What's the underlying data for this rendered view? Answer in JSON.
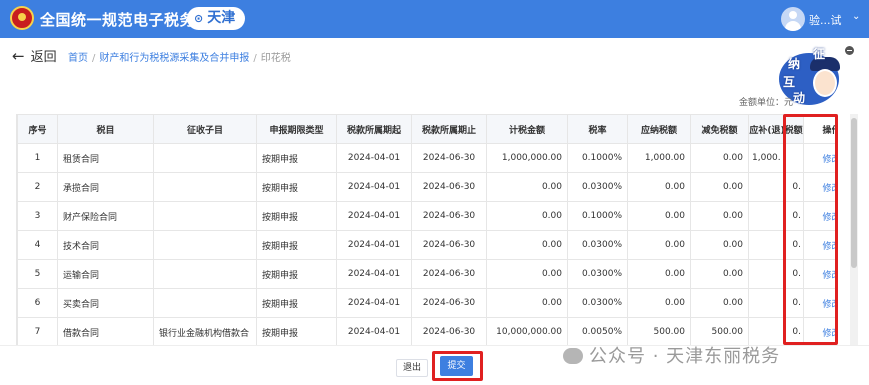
{
  "header": {
    "title": "全国统一规范电子税务局",
    "region": "天津",
    "username": "验...试"
  },
  "breadcrumb": {
    "back": "返回",
    "items": [
      "首页",
      "财产和行为税税源采集及合并申报",
      "印花税"
    ]
  },
  "mascot": {
    "chars": [
      "征",
      "纳",
      "互",
      "动"
    ]
  },
  "unit_label": "金额单位：元",
  "table": {
    "headers": [
      "序号",
      "税目",
      "征收子目",
      "申报期限类型",
      "税款所属期起",
      "税款所属期止",
      "计税金额",
      "税率",
      "应纳税额",
      "减免税额",
      "应补(退)税额",
      "操作"
    ],
    "rows": [
      {
        "no": "1",
        "item": "租赁合同",
        "sub": "",
        "period": "按期申报",
        "start": "2024-04-01",
        "end": "2024-06-30",
        "base": "1,000,000.00",
        "rate": "0.1000%",
        "payable": "1,000.00",
        "relief": "0.00",
        "due": "1,000.",
        "op": "修改"
      },
      {
        "no": "2",
        "item": "承揽合同",
        "sub": "",
        "period": "按期申报",
        "start": "2024-04-01",
        "end": "2024-06-30",
        "base": "0.00",
        "rate": "0.0300%",
        "payable": "0.00",
        "relief": "0.00",
        "due": "0.",
        "op": "修改"
      },
      {
        "no": "3",
        "item": "财产保险合同",
        "sub": "",
        "period": "按期申报",
        "start": "2024-04-01",
        "end": "2024-06-30",
        "base": "0.00",
        "rate": "0.1000%",
        "payable": "0.00",
        "relief": "0.00",
        "due": "0.",
        "op": "修改"
      },
      {
        "no": "4",
        "item": "技术合同",
        "sub": "",
        "period": "按期申报",
        "start": "2024-04-01",
        "end": "2024-06-30",
        "base": "0.00",
        "rate": "0.0300%",
        "payable": "0.00",
        "relief": "0.00",
        "due": "0.",
        "op": "修改"
      },
      {
        "no": "5",
        "item": "运输合同",
        "sub": "",
        "period": "按期申报",
        "start": "2024-04-01",
        "end": "2024-06-30",
        "base": "0.00",
        "rate": "0.0300%",
        "payable": "0.00",
        "relief": "0.00",
        "due": "0.",
        "op": "修改"
      },
      {
        "no": "6",
        "item": "买卖合同",
        "sub": "",
        "period": "按期申报",
        "start": "2024-04-01",
        "end": "2024-06-30",
        "base": "0.00",
        "rate": "0.0300%",
        "payable": "0.00",
        "relief": "0.00",
        "due": "0.",
        "op": "修改"
      },
      {
        "no": "7",
        "item": "借款合同",
        "sub": "银行业金融机构借款合",
        "period": "按期申报",
        "start": "2024-04-01",
        "end": "2024-06-30",
        "base": "10,000,000.00",
        "rate": "0.0050%",
        "payable": "500.00",
        "relief": "500.00",
        "due": "0.",
        "op": "修改"
      }
    ]
  },
  "buttons": {
    "exit": "退出",
    "submit": "提交"
  },
  "watermark": "公众号 · 天津东丽税务",
  "colors": {
    "header": "#3d7fe0",
    "link": "#3d7fe0",
    "highlight": "#e02020"
  }
}
